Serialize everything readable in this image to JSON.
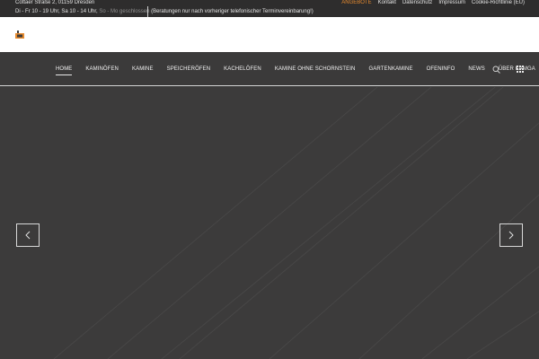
{
  "topbar": {
    "address": "Cottaer Straße 2, 01159 Dresden",
    "hours_main": "Di - Fr 10 - 19 Uhr, Sa 10 - 14 Uhr,",
    "hours_closed": "So - Mo geschlossen",
    "hours_note": "(Beratungen nur nach vorheriger telefonischer Terminvereinbarung!)",
    "links": [
      "ANGEBOTE",
      "Kontakt",
      "Datenschutz",
      "Impressum",
      "Cookie-Richtlinie (EU)"
    ]
  },
  "nav": {
    "items": [
      "HOME",
      "KAMINÖFEN",
      "KAMINE",
      "SPEICHERÖFEN",
      "KACHELÖFEN",
      "KAMINE OHNE SCHORNSTEIN",
      "GARTENKAMINE",
      "OFENINFO",
      "NEWS",
      "ÜBER KAMGA"
    ],
    "active": "HOME"
  },
  "icons": {
    "logo": "kamga-logo",
    "search": "search-icon",
    "menu": "grid-menu-icon",
    "prev": "chevron-left-icon",
    "next": "chevron-right-icon"
  },
  "colors": {
    "accent": "#e68a2e",
    "dark": "#3b3a3a",
    "topbar": "#2e2d2d"
  }
}
